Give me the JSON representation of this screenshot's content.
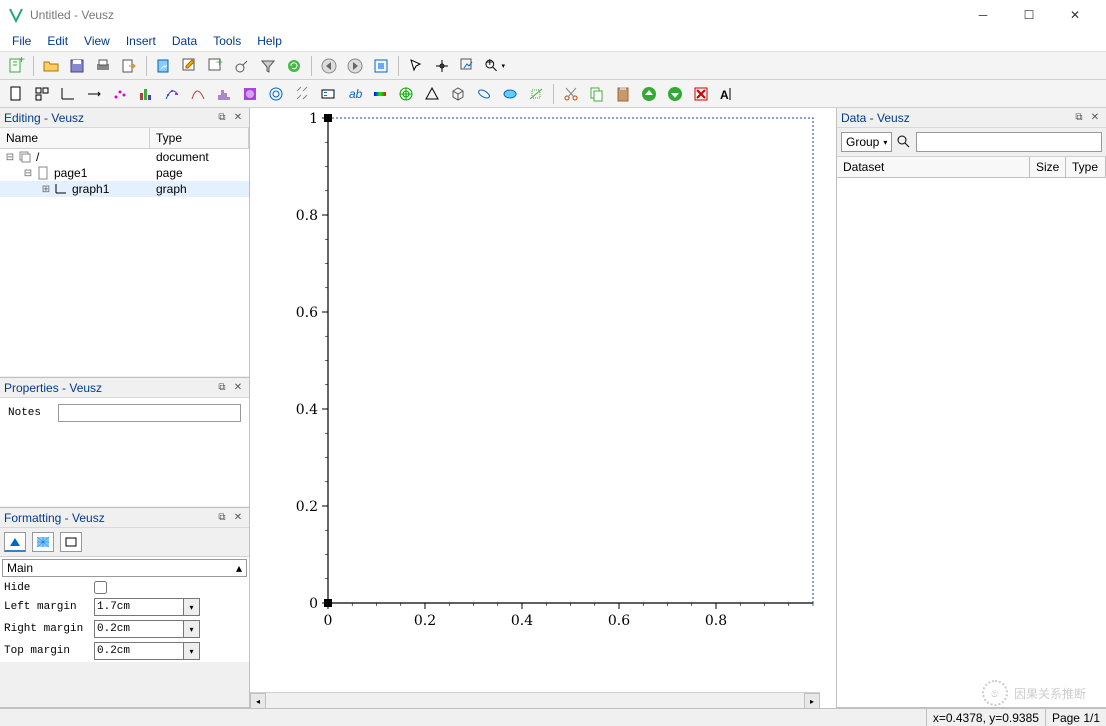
{
  "window": {
    "title": "Untitled - Veusz"
  },
  "menu": {
    "items": [
      "File",
      "Edit",
      "View",
      "Insert",
      "Data",
      "Tools",
      "Help"
    ]
  },
  "panels": {
    "editing": {
      "title": "Editing - Veusz",
      "header_name": "Name",
      "header_type": "Type",
      "rows": [
        {
          "indent": 0,
          "expand": "-",
          "icon": "stack",
          "name": "/",
          "type": "document"
        },
        {
          "indent": 1,
          "expand": "-",
          "icon": "page",
          "name": "page1",
          "type": "page"
        },
        {
          "indent": 2,
          "expand": "+",
          "icon": "graph",
          "name": "graph1",
          "type": "graph",
          "selected": true
        }
      ]
    },
    "properties": {
      "title": "Properties - Veusz",
      "notes_label": "Notes",
      "notes_value": ""
    },
    "formatting": {
      "title": "Formatting - Veusz",
      "section": "Main",
      "hide_label": "Hide",
      "left_margin_label": "Left margin",
      "left_margin_value": "1.7cm",
      "right_margin_label": "Right margin",
      "right_margin_value": "0.2cm",
      "top_margin_label": "Top margin",
      "top_margin_value": "0.2cm"
    },
    "data": {
      "title": "Data - Veusz",
      "group_label": "Group",
      "header_dataset": "Dataset",
      "header_size": "Size",
      "header_type": "Type"
    }
  },
  "chart_data": {
    "type": "scatter",
    "x": [],
    "y": [],
    "xlim": [
      0,
      1
    ],
    "ylim": [
      0,
      1
    ],
    "xticks": [
      0,
      0.2,
      0.4,
      0.6,
      0.8
    ],
    "yticks": [
      0,
      0.2,
      0.4,
      0.6,
      0.8,
      1
    ],
    "title": "",
    "xlabel": "",
    "ylabel": ""
  },
  "statusbar": {
    "coords": "x=0.4378, y=0.9385",
    "page": "Page 1/1"
  },
  "watermark": "因果关系推断"
}
